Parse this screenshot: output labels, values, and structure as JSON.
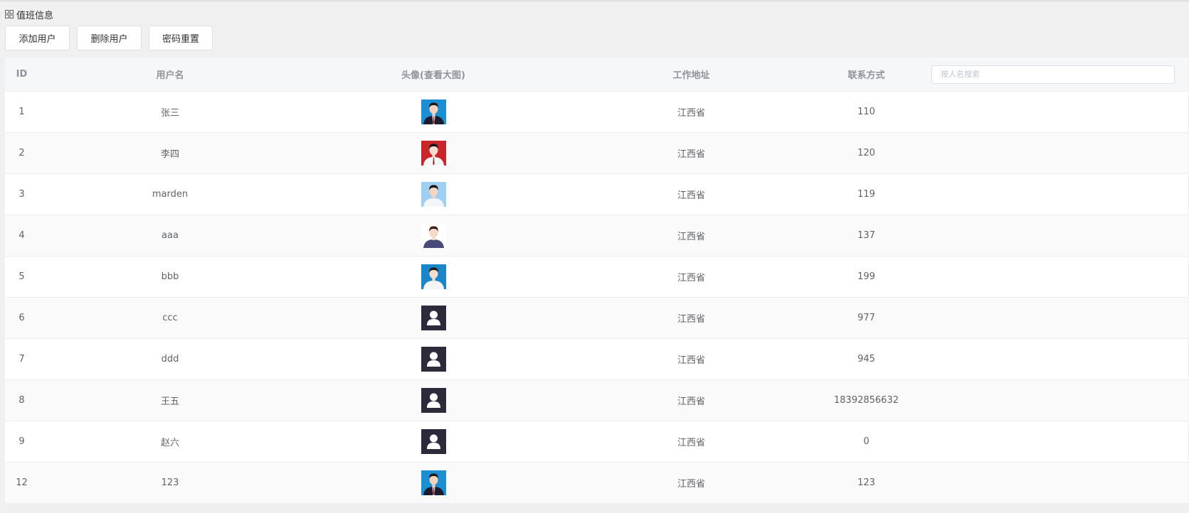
{
  "page": {
    "title": "值班信息",
    "title_icon": "grid-icon"
  },
  "toolbar": {
    "add_label": "添加用户",
    "delete_label": "删除用户",
    "reset_label": "密码重置"
  },
  "table": {
    "headers": {
      "id": "ID",
      "username": "用户名",
      "avatar": "头像(查看大图)",
      "address": "工作地址",
      "contact": "联系方式"
    },
    "search_placeholder": "按人名搜索",
    "rows": [
      {
        "id": "1",
        "name": "张三",
        "address": "江西省",
        "contact": "110",
        "avatar": "photo-man-suit-blue"
      },
      {
        "id": "2",
        "name": "李四",
        "address": "江西省",
        "contact": "120",
        "avatar": "photo-woman-red"
      },
      {
        "id": "3",
        "name": "marden",
        "address": "江西省",
        "contact": "119",
        "avatar": "photo-man-lightblue"
      },
      {
        "id": "4",
        "name": "aaa",
        "address": "江西省",
        "contact": "137",
        "avatar": "photo-girl-white"
      },
      {
        "id": "5",
        "name": "bbb",
        "address": "江西省",
        "contact": "199",
        "avatar": "photo-girl-blue"
      },
      {
        "id": "6",
        "name": "ccc",
        "address": "江西省",
        "contact": "977",
        "avatar": "default-user-icon"
      },
      {
        "id": "7",
        "name": "ddd",
        "address": "江西省",
        "contact": "945",
        "avatar": "default-user-icon"
      },
      {
        "id": "8",
        "name": "王五",
        "address": "江西省",
        "contact": "18392856632",
        "avatar": "default-user-icon"
      },
      {
        "id": "9",
        "name": "赵六",
        "address": "江西省",
        "contact": "0",
        "avatar": "default-user-icon"
      },
      {
        "id": "12",
        "name": "123",
        "address": "江西省",
        "contact": "123",
        "avatar": "photo-man-suit-blue"
      }
    ]
  },
  "colors": {
    "page_background": "#f0f0f0",
    "header_background": "#f6f7f9",
    "stripe_background": "#fafafa",
    "border": "#ebeef5",
    "default_avatar": "#2b2b3b"
  }
}
